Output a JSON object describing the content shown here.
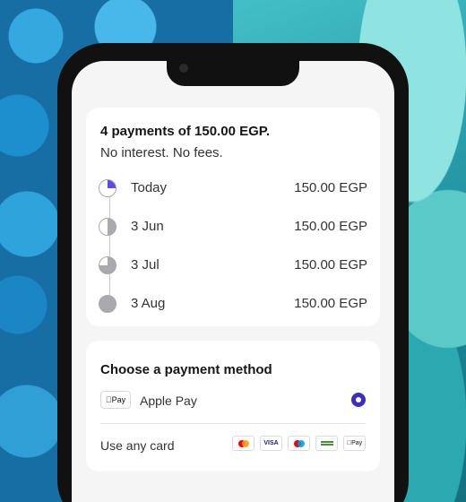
{
  "plan": {
    "title": "4 payments of 150.00 EGP.",
    "subtitle": "No interest. No fees.",
    "installments": [
      {
        "label": "Today",
        "amount": "150.00 EGP",
        "progress": 0.25
      },
      {
        "label": "3 Jun",
        "amount": "150.00 EGP",
        "progress": 0.5
      },
      {
        "label": "3 Jul",
        "amount": "150.00 EGP",
        "progress": 0.75
      },
      {
        "label": "3 Aug",
        "amount": "150.00 EGP",
        "progress": 1.0
      }
    ]
  },
  "payment": {
    "title": "Choose a payment method",
    "apple_pay_badge": "Pay",
    "apple_pay_label": "Apple Pay",
    "apple_pay_selected": true,
    "card_label": "Use any card",
    "card_brands": [
      "mastercard-icon",
      "visa-icon",
      "maestro-icon",
      "bank-card-icon",
      "apple-pay-icon"
    ],
    "visa_text": "VISA",
    "apple_pay_small": "Pay"
  },
  "colors": {
    "accent": "#3b31b8",
    "progress_fill": "#5b4ce6"
  }
}
